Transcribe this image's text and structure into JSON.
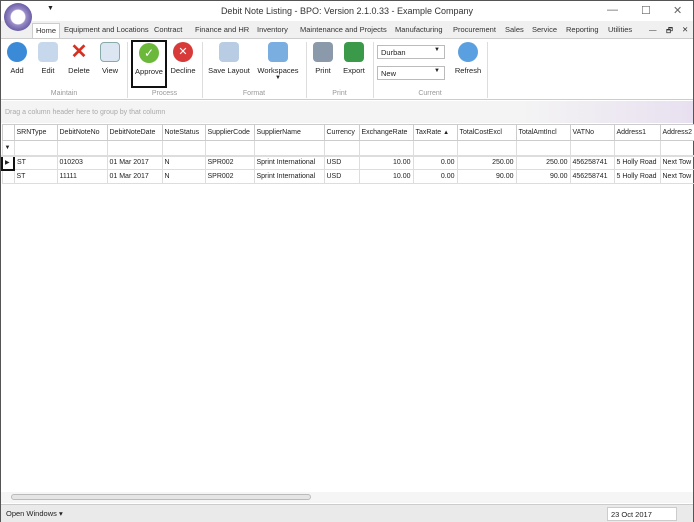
{
  "window": {
    "title": "Debit Note Listing - BPO: Version 2.1.0.33 - Example Company"
  },
  "tabs": [
    "Home",
    "Equipment and Locations",
    "Contract",
    "Finance and HR",
    "Inventory",
    "Maintenance and Projects",
    "Manufacturing",
    "Procurement",
    "Sales",
    "Service",
    "Reporting",
    "Utilities"
  ],
  "ribbon": {
    "buttons": {
      "add": "Add",
      "edit": "Edit",
      "delete": "Delete",
      "view": "View",
      "approve": "Approve",
      "decline": "Decline",
      "save_layout": "Save Layout",
      "workspaces": "Workspaces",
      "print": "Print",
      "export": "Export",
      "refresh": "Refresh"
    },
    "groups": {
      "maintain": "Maintain",
      "process": "Process",
      "format": "Format",
      "print": "Print",
      "current": "Current"
    },
    "site_select": "Durban",
    "status_select": "New"
  },
  "grid": {
    "group_hint": "Drag a column header here to group by that column",
    "columns": [
      "SRNType",
      "DebitNoteNo",
      "DebitNoteDate",
      "NoteStatus",
      "SupplierCode",
      "SupplierName",
      "Currency",
      "ExchangeRate",
      "TaxRate",
      "TotalCostExcl",
      "TotalAmtIncl",
      "VATNo",
      "Address1",
      "Address2"
    ],
    "sort_indicator": "▲",
    "rows": [
      [
        "ST",
        "010203",
        "01 Mar 2017",
        "N",
        "SPR002",
        "Sprint International",
        "USD",
        "10.00",
        "0.00",
        "250.00",
        "250.00",
        "456258741",
        "5 Holly Road",
        "Next Tow"
      ],
      [
        "ST",
        "11111",
        "01 Mar 2017",
        "N",
        "SPR002",
        "Sprint International",
        "USD",
        "10.00",
        "0.00",
        "90.00",
        "90.00",
        "456258741",
        "5 Holly Road",
        "Next Tow"
      ]
    ]
  },
  "statusbar": {
    "open_windows": "Open Windows ▾",
    "date": "23 Oct 2017"
  }
}
